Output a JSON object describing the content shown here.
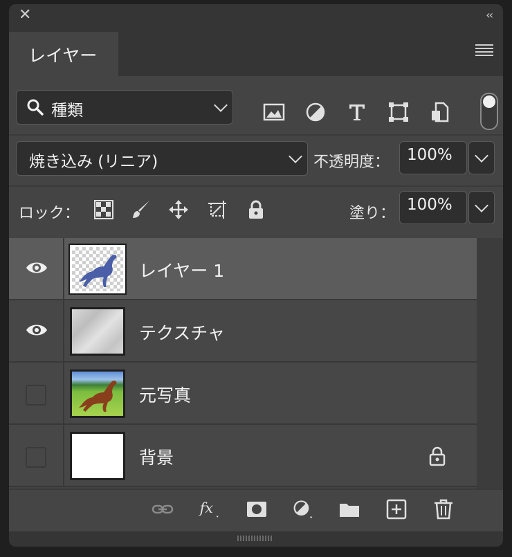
{
  "panel": {
    "tab_label": "レイヤー"
  },
  "filter": {
    "kind_label": "種類"
  },
  "blend": {
    "mode_label": "焼き込み (リニア)",
    "opacity_label": "不透明度：",
    "opacity_value": "100%"
  },
  "lock": {
    "label": "ロック：",
    "fill_label": "塗り：",
    "fill_value": "100%"
  },
  "layers": [
    {
      "name": "レイヤー 1",
      "visible": true,
      "selected": true,
      "thumbnail": "horse-silhouette-transparent"
    },
    {
      "name": "テクスチャ",
      "visible": true,
      "selected": false,
      "thumbnail": "gray-texture"
    },
    {
      "name": "元写真",
      "visible": false,
      "selected": false,
      "thumbnail": "horse-photo"
    },
    {
      "name": "背景",
      "visible": false,
      "selected": false,
      "thumbnail": "white",
      "locked": true
    }
  ],
  "colors": {
    "panel_bg": "#444444",
    "selected_row": "#5c5c5c",
    "field_bg": "#2e2e2e"
  }
}
